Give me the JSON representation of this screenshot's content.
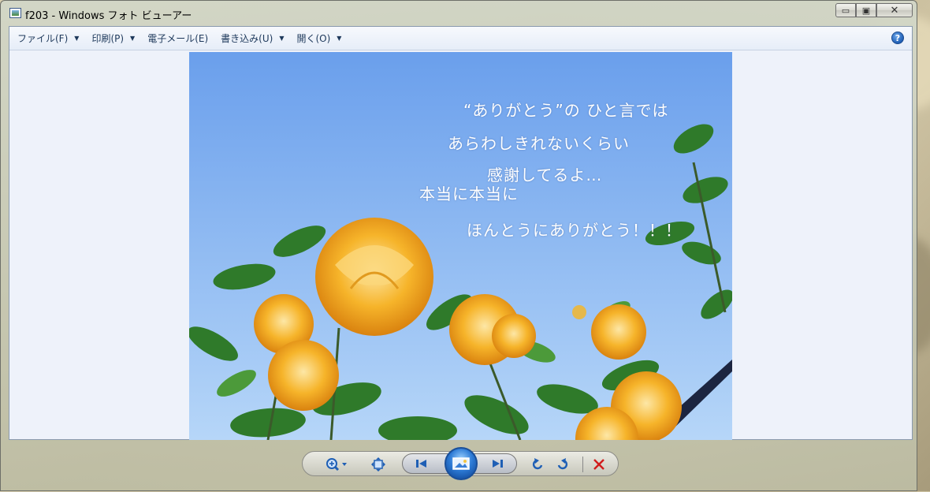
{
  "window": {
    "title": "f203 - Windows フォト ビューアー",
    "minimize_glyph": "▭",
    "maximize_glyph": "▣",
    "close_glyph": "✕"
  },
  "menubar": {
    "items": [
      {
        "label": "ファイル(F)",
        "has_dropdown": true
      },
      {
        "label": "印刷(P)",
        "has_dropdown": true
      },
      {
        "label": "電子メール(E)",
        "has_dropdown": false
      },
      {
        "label": "書き込み(U)",
        "has_dropdown": true
      },
      {
        "label": "開く(O)",
        "has_dropdown": true
      }
    ],
    "caret_glyph": "▼",
    "help_glyph": "?"
  },
  "photo": {
    "lines": [
      "“ありがとう”の ひと言では",
      "あらわしきれないくらい",
      "感謝してるよ…",
      "本当に本当に",
      "ほんとうにありがとう！！！"
    ]
  },
  "toolbar": {
    "icons": [
      "zoom-icon",
      "actual-size-icon",
      "previous-icon",
      "slideshow-icon",
      "next-icon",
      "rotate-left-icon",
      "rotate-right-icon",
      "delete-icon"
    ]
  },
  "colors": {
    "menu_text": "#1e395b",
    "sky": "#7fb0f0",
    "rose": "#f6b42a",
    "leaf": "#2f7a2a",
    "delete": "#d11c1c"
  }
}
